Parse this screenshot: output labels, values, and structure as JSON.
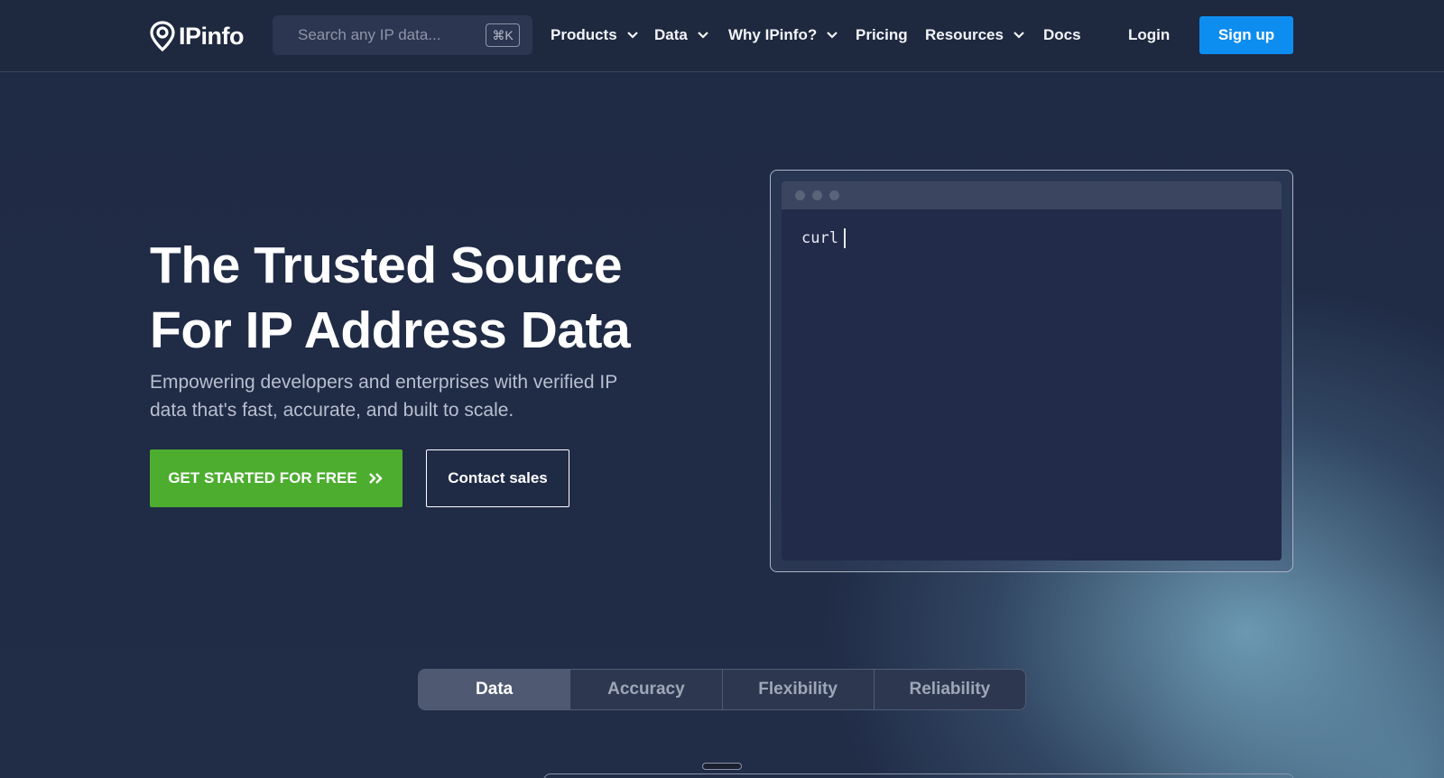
{
  "header": {
    "logo_text": "IPinfo",
    "search_placeholder": "Search any IP data...",
    "search_shortcut": "⌘K",
    "nav": [
      {
        "label": "Products",
        "dropdown": true
      },
      {
        "label": "Data",
        "dropdown": true
      },
      {
        "label": "Why IPinfo?",
        "dropdown": true
      },
      {
        "label": "Pricing",
        "dropdown": false
      },
      {
        "label": "Resources",
        "dropdown": true
      },
      {
        "label": "Docs",
        "dropdown": false
      }
    ],
    "login_label": "Login",
    "signup_label": "Sign up"
  },
  "hero": {
    "title_line1": "The Trusted Source",
    "title_line2": "For IP Address Data",
    "subtitle_line1": "Empowering developers and enterprises with verified IP",
    "subtitle_line2": "data that's fast, accurate, and built to scale.",
    "primary_cta": "GET STARTED FOR FREE",
    "secondary_cta": "Contact sales"
  },
  "terminal": {
    "command": "curl"
  },
  "tabs": [
    {
      "label": "Data",
      "active": true
    },
    {
      "label": "Accuracy",
      "active": false
    },
    {
      "label": "Flexibility",
      "active": false
    },
    {
      "label": "Reliability",
      "active": false
    }
  ],
  "colors": {
    "background": "#1f2a44",
    "primary_cta": "#4cad2f",
    "signup": "#0e8df0"
  }
}
